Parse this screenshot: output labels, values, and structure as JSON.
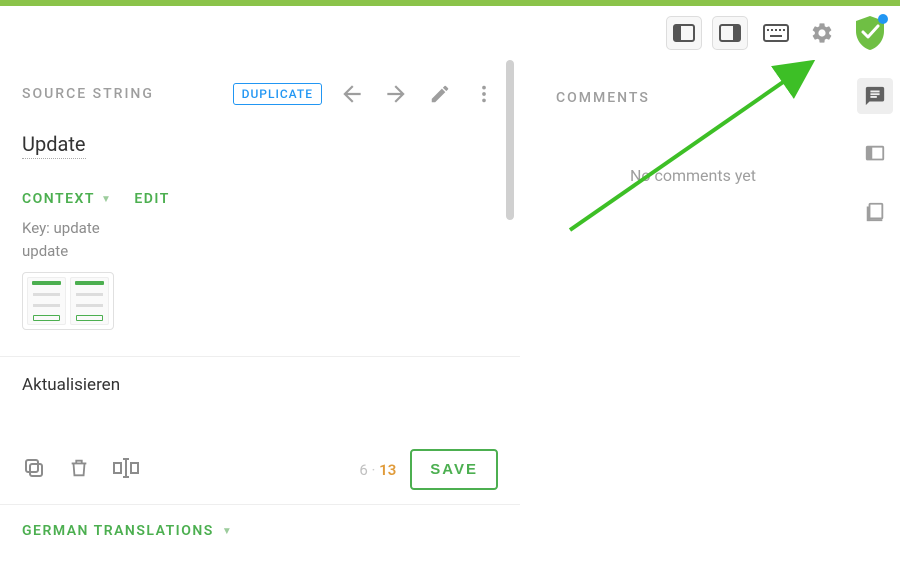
{
  "header": {
    "source_label": "SOURCE STRING",
    "duplicate_pill": "DUPLICATE"
  },
  "source": {
    "word": "Update",
    "context_label": "CONTEXT",
    "edit_label": "EDIT",
    "key_line": "Key: update",
    "key_value": "update"
  },
  "translation": {
    "value": "Aktualisieren",
    "count_current": "6",
    "count_sep": " · ",
    "count_max": "13",
    "save_label": "SAVE"
  },
  "footer": {
    "label": "GERMAN TRANSLATIONS"
  },
  "comments": {
    "header": "COMMENTS",
    "empty": "No comments yet"
  }
}
